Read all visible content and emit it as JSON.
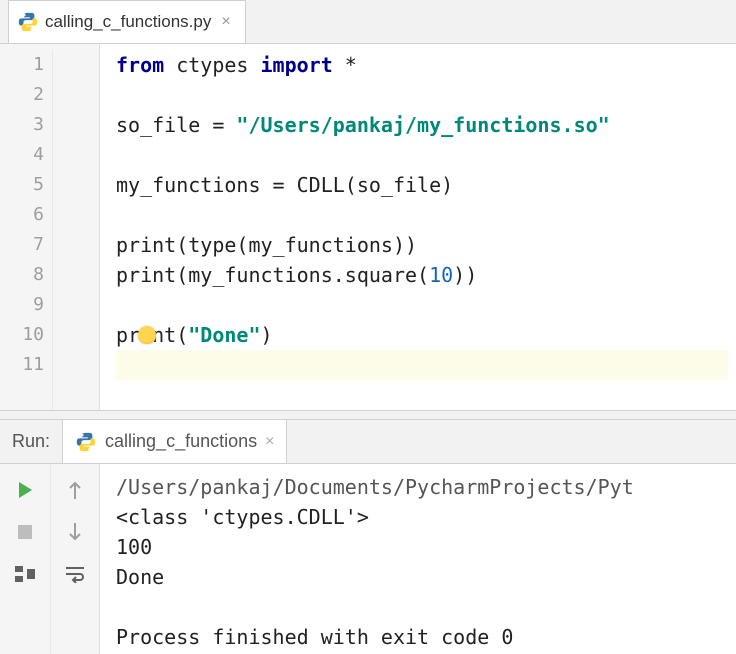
{
  "editorTab": {
    "filename": "calling_c_functions.py"
  },
  "code": {
    "lines": [
      {
        "n": "1",
        "tokens": [
          [
            "kw",
            "from"
          ],
          [
            "",
            " ctypes "
          ],
          [
            "kw",
            "import"
          ],
          [
            "",
            " *"
          ]
        ]
      },
      {
        "n": "2",
        "tokens": []
      },
      {
        "n": "3",
        "tokens": [
          [
            "",
            "so_file = "
          ],
          [
            "str",
            "\"/Users/pankaj/my_functions.so\""
          ]
        ]
      },
      {
        "n": "4",
        "tokens": []
      },
      {
        "n": "5",
        "tokens": [
          [
            "",
            "my_functions = CDLL(so_file)"
          ]
        ]
      },
      {
        "n": "6",
        "tokens": []
      },
      {
        "n": "7",
        "tokens": [
          [
            "",
            "print(type(my_functions))"
          ]
        ]
      },
      {
        "n": "8",
        "tokens": [
          [
            "",
            "print(my_functions.square("
          ],
          [
            "num",
            "10"
          ],
          [
            "",
            "))"
          ]
        ]
      },
      {
        "n": "9",
        "tokens": []
      },
      {
        "n": "10",
        "tokens": [
          [
            "",
            "print("
          ],
          [
            "str",
            "\"Done\""
          ],
          [
            "",
            ")"
          ]
        ],
        "bulb": true
      },
      {
        "n": "11",
        "tokens": [],
        "highlight": true
      }
    ]
  },
  "runPanel": {
    "label": "Run:",
    "tabName": "calling_c_functions",
    "output": [
      "/Users/pankaj/Documents/PycharmProjects/Pyt",
      "<class 'ctypes.CDLL'>",
      "100",
      "Done",
      "",
      "Process finished with exit code 0"
    ]
  }
}
